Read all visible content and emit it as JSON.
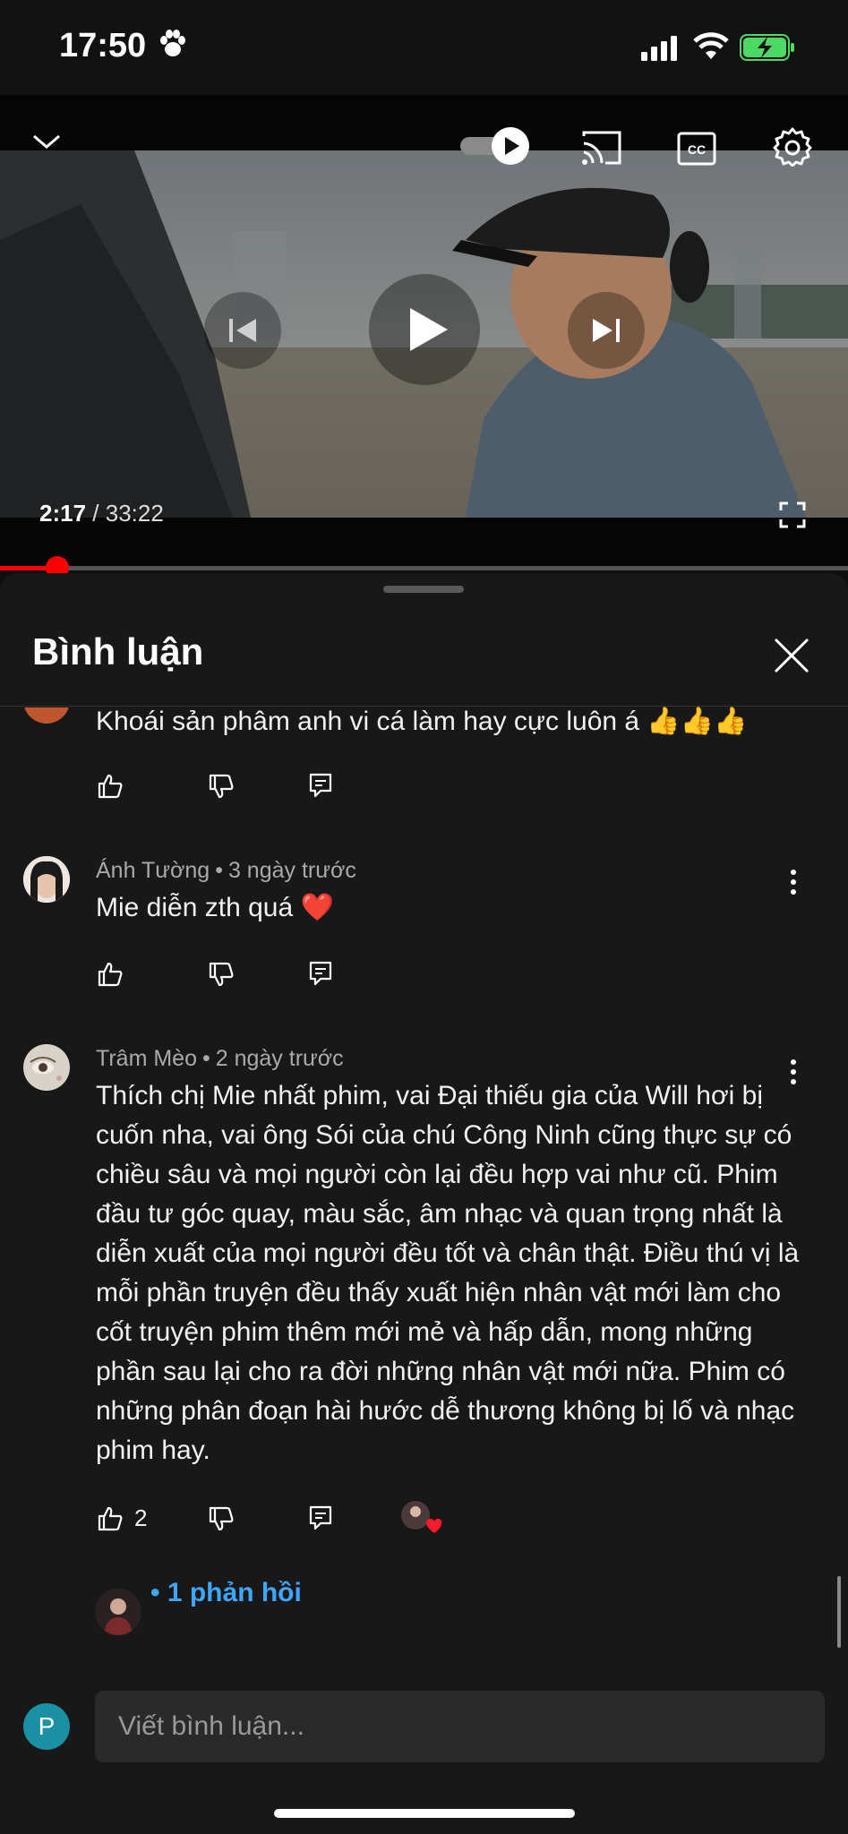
{
  "status": {
    "time": "17:50"
  },
  "player": {
    "current_time": "2:17",
    "separator": "/",
    "total_time": "33:22",
    "progress": 0.068
  },
  "comments_panel": {
    "title": "Bình luận",
    "comments": [
      {
        "text": "Khoái sản phâm anh vi cá làm hay cực luôn á 👍👍👍"
      },
      {
        "author": "Ánh Tường",
        "time": "3 ngày trước",
        "text": "Mie diễn zth quá ❤️"
      },
      {
        "author": "Trâm Mèo",
        "time": "2 ngày trước",
        "text": "Thích chị Mie nhất phim, vai Đại thiếu gia của Will hơi bị cuốn nha, vai ông Sói của chú Công Ninh cũng thực sự có chiều sâu và mọi người còn lại đều hợp vai như cũ. Phim đầu tư góc quay, màu sắc, âm nhạc và quan trọng nhất là diễn xuất của mọi người đều tốt và chân thật. Điều thú vị là mỗi phần truyện đều thấy xuất hiện nhân vật mới làm cho cốt truyện phim thêm mới mẻ và hấp dẫn, mong những phần sau lại cho ra đời những nhân vật mới nữa. Phim có những phân đoạn hài hước dễ thương không bị lố và nhạc phim hay.",
        "likes": "2",
        "replies_label": "• 1 phản hồi"
      }
    ],
    "input": {
      "placeholder": "Viết bình luận...",
      "user_initial": "P"
    }
  }
}
